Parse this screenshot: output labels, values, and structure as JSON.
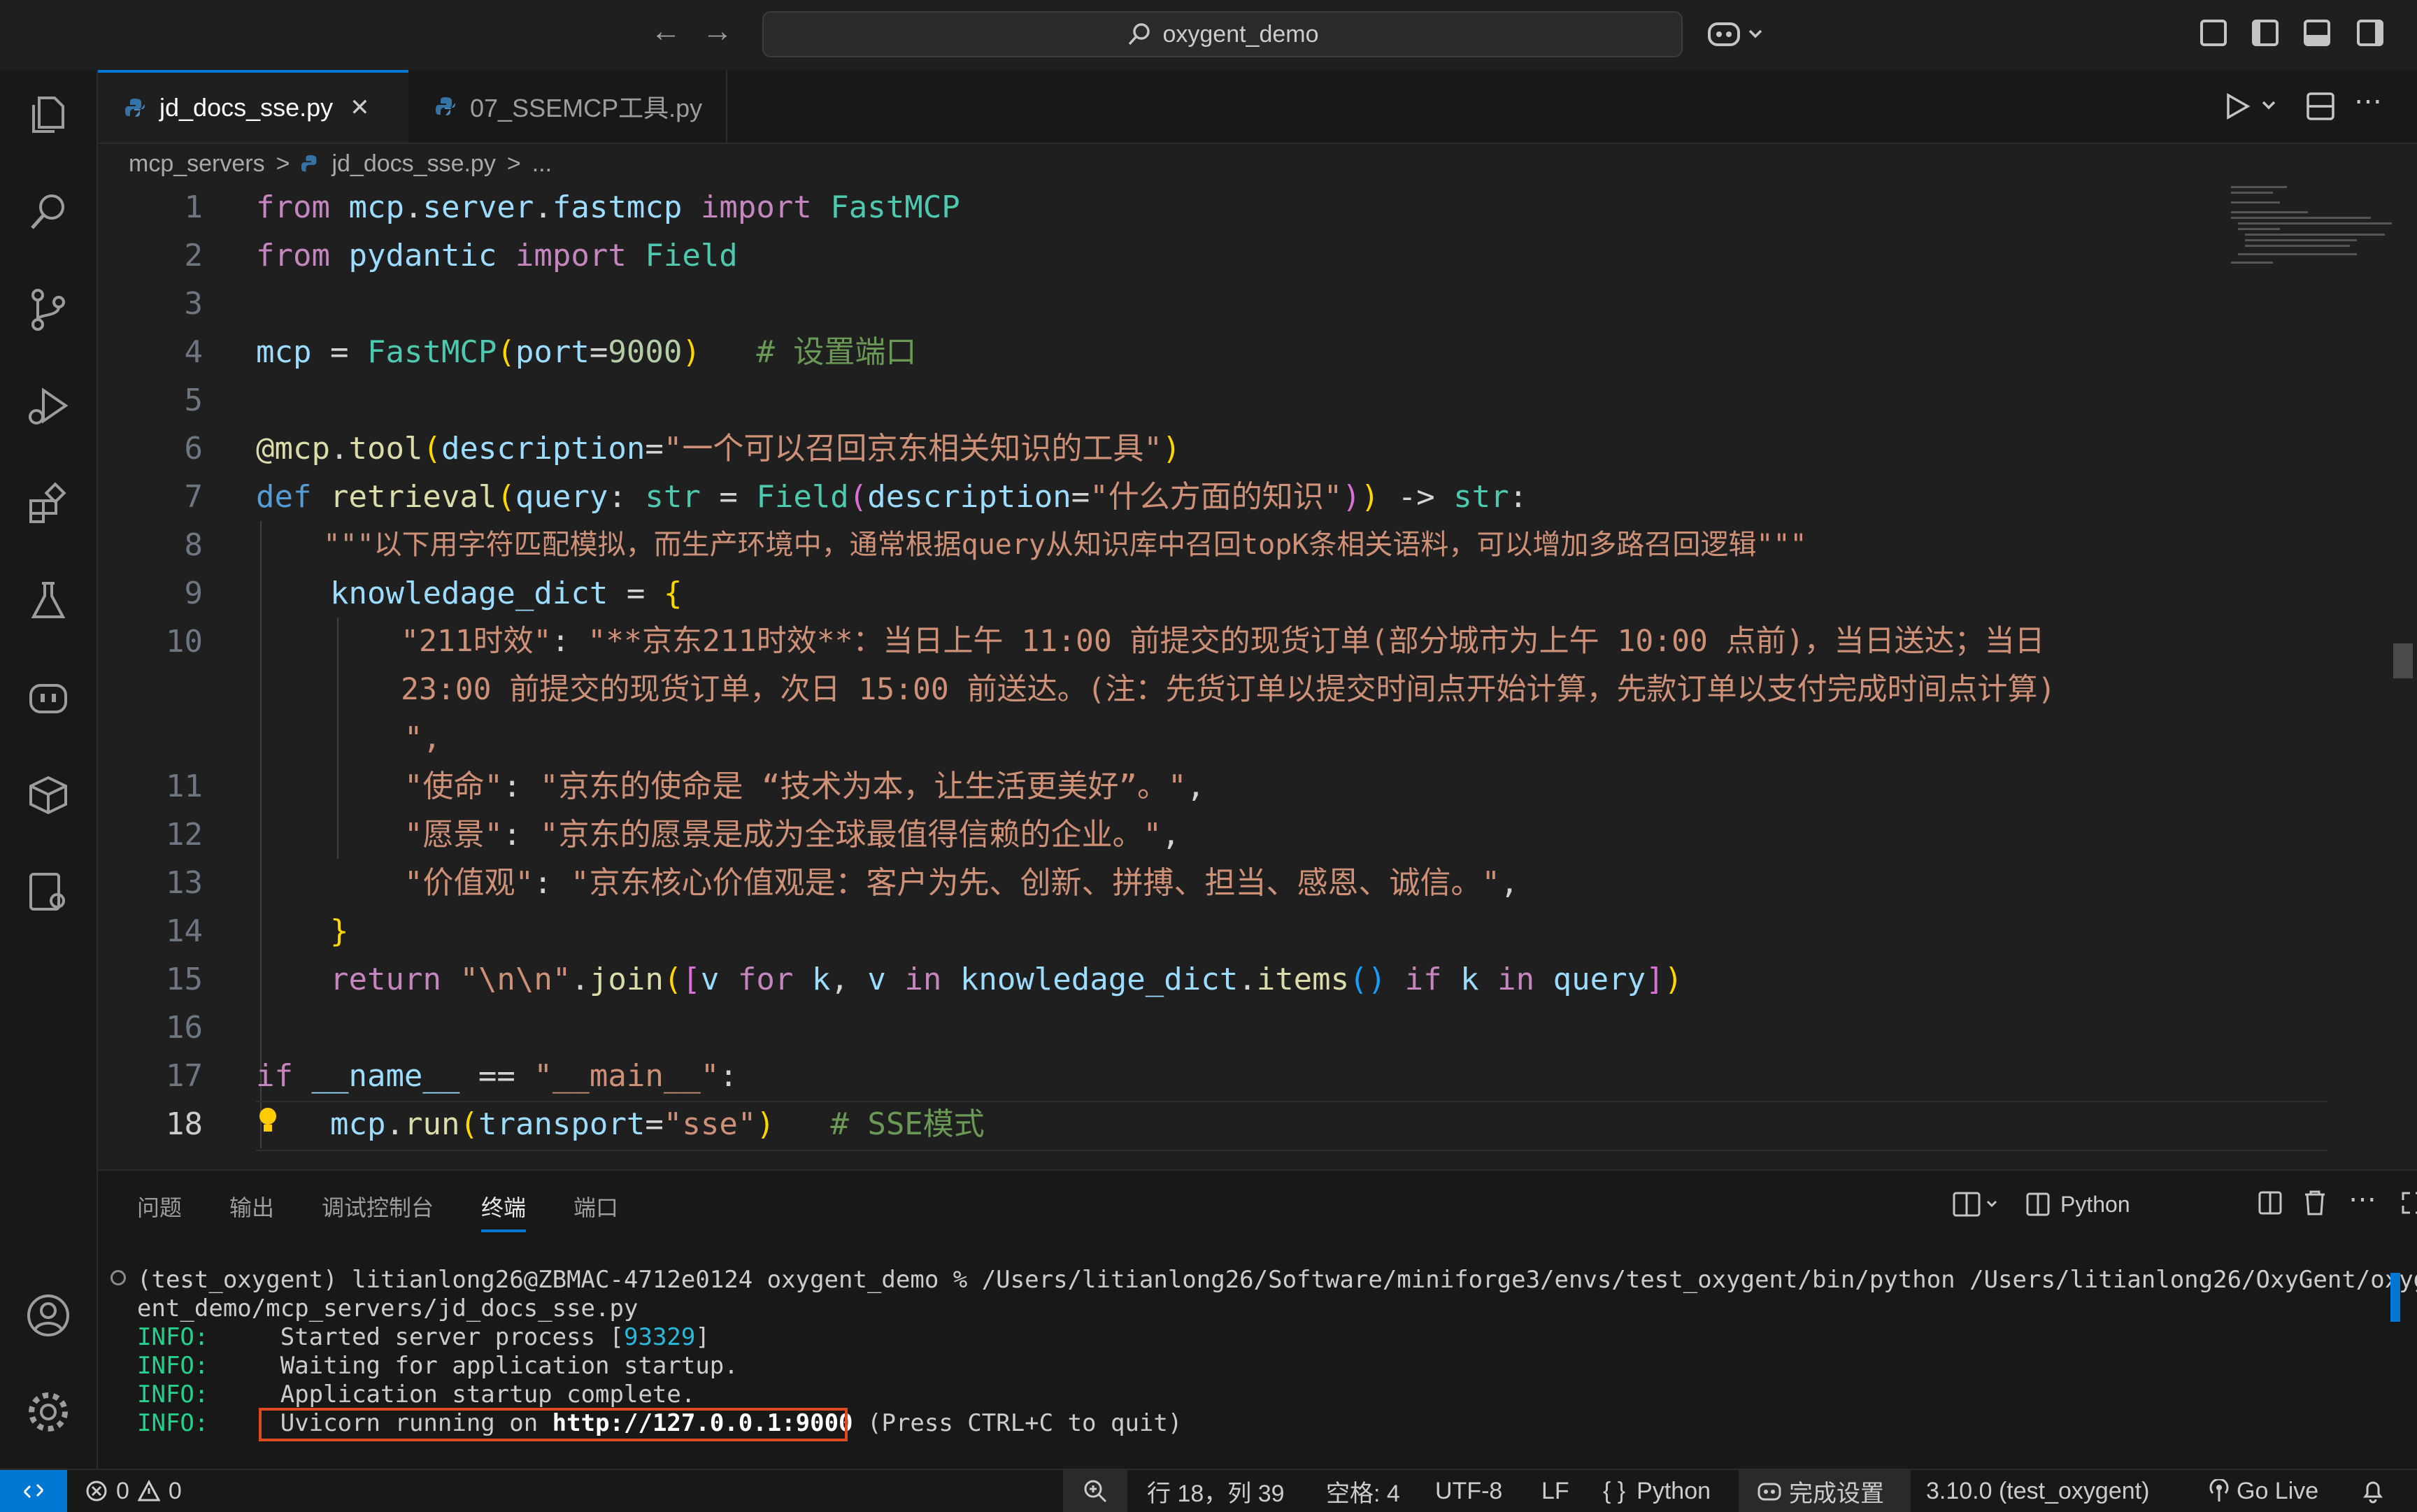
{
  "titlebar": {
    "search_text": "oxygent_demo",
    "back": "←",
    "forward": "→"
  },
  "tabs": [
    {
      "label": "jd_docs_sse.py",
      "close": "✕"
    },
    {
      "label": "07_SSEMCP工具.py"
    }
  ],
  "breadcrumb": {
    "folder": "mcp_servers",
    "file": "jd_docs_sse.py",
    "sep": ">",
    "more": "..."
  },
  "editor": {
    "line_numbers": [
      "1",
      "2",
      "3",
      "4",
      "5",
      "6",
      "7",
      "8",
      "9",
      "10",
      "",
      "",
      "11",
      "12",
      "13",
      "14",
      "15",
      "16",
      "17",
      "18"
    ],
    "lines": [
      "from mcp.server.fastmcp import FastMCP",
      "from pydantic import Field",
      "",
      "mcp = FastMCP(port=9000)   # 设置端口",
      "",
      "@mcp.tool(description=\"一个可以召回京东相关知识的工具\")",
      "def retrieval(query: str = Field(description=\"什么方面的知识\")) -> str:",
      "    \"\"\"以下用字符匹配模拟，而生产环境中，通常根据query从知识库中召回topK条相关语料，可以增加多路召回逻辑\"\"\"",
      "    knowledage_dict = {",
      "        \"211时效\": \"**京东211时效**：当日上午 11:00 前提交的现货订单(部分城市为上午 10:00 点前)，当日送达；当日",
      "        23:00 前提交的现货订单，次日 15:00 前送达。(注：先货订单以提交时间点开始计算，先款订单以支付完成时间点计算)",
      "        \",",
      "        \"使命\": \"京东的使命是 “技术为本，让生活更美好”。\",",
      "        \"愿景\": \"京东的愿景是成为全球最值得信赖的企业。\",",
      "        \"价值观\": \"京东核心价值观是：客户为先、创新、拼搏、担当、感恩、诚信。\",",
      "    }",
      "    return \"\\n\\n\".join([v for k, v in knowledage_dict.items() if k in query])",
      "",
      "if __name__ == \"__main__\":",
      "    mcp.run(transport=\"sse\")   # SSE模式"
    ]
  },
  "panel": {
    "tabs": [
      "问题",
      "输出",
      "调试控制台",
      "终端",
      "端口"
    ],
    "active_tab": "终端",
    "profile": "Python",
    "terminal_lines": [
      "(test_oxygent) litianlong26@ZBMAC-4712e0124 oxygent_demo % /Users/litianlong26/Software/miniforge3/envs/test_oxygent/bin/python /Users/litianlong26/OxyGent/oxyg",
      "ent_demo/mcp_servers/jd_docs_sse.py",
      "INFO:     Started server process [93329]",
      "INFO:     Waiting for application startup.",
      "INFO:     Application startup complete.",
      "INFO:     Uvicorn running on http://127.0.0.1:9000 (Press CTRL+C to quit)"
    ],
    "info_label": "INFO:",
    "pid": "93329",
    "uvicorn_prefix": "Uvicorn running on ",
    "uvicorn_url": "http://127.0.0.1:9000",
    "uvicorn_suffix": " (Press CTRL+C to quit)",
    "started_prefix": "Started server process [",
    "started_suffix": "]",
    "waiting": "Waiting for application startup.",
    "complete": "Application startup complete.",
    "cmd_line1": "(test_oxygent) litianlong26@ZBMAC-4712e0124 oxygent_demo % /Users/litianlong26/Software/miniforge3/envs/test_oxygent/bin/python /Users/litianlong26/OxyGent/oxyg",
    "cmd_line2": "ent_demo/mcp_servers/jd_docs_sse.py"
  },
  "statusbar": {
    "errors": "0",
    "warnings": "0",
    "cursor": "行 18，列 39",
    "spaces": "空格: 4",
    "encoding": "UTF-8",
    "eol": "LF",
    "language_braces": "{ }",
    "language": "Python",
    "setup": "完成设置",
    "interpreter": "3.10.0 (test_oxygent)",
    "golive": "Go Live"
  },
  "colors": {
    "accent": "#0078d4",
    "highlight_box": "#e0481e",
    "terminal_info": "#23d18b"
  }
}
